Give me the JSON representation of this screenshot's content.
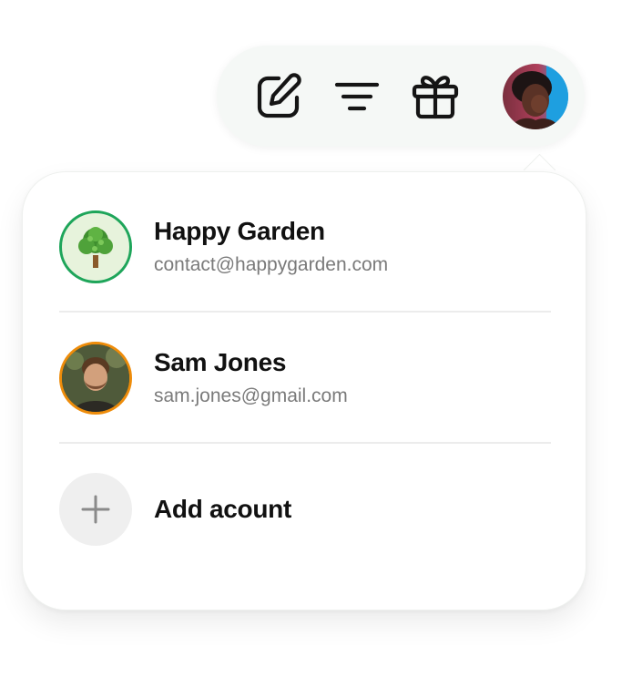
{
  "toolbar": {
    "icons": [
      "edit-icon",
      "filter-icon",
      "gift-icon"
    ],
    "user_avatar": "profile-photo"
  },
  "accounts": [
    {
      "name": "Happy Garden",
      "email": "contact@happygarden.com",
      "avatar": "tree-icon",
      "ring_color": "#1ea55a"
    },
    {
      "name": "Sam Jones",
      "email": "sam.jones@gmail.com",
      "avatar": "profile-photo",
      "ring_color": "#ee8c0a"
    }
  ],
  "add_account": {
    "label": "Add acount",
    "icon": "plus-icon"
  }
}
